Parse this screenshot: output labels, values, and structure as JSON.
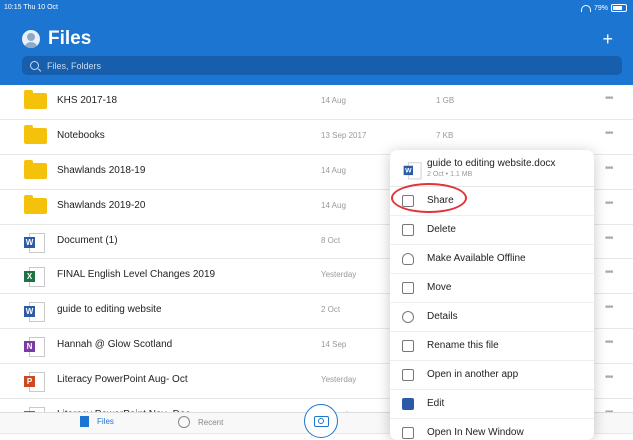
{
  "status": {
    "time": "10:15  Thu 10 Oct",
    "battery": "79%"
  },
  "header": {
    "title": "Files",
    "search_placeholder": "Files, Folders"
  },
  "files": [
    {
      "name": "KHS 2017-18",
      "date": "14 Aug",
      "size": "1 GB",
      "type": "folder"
    },
    {
      "name": "Notebooks",
      "date": "13 Sep 2017",
      "size": "7 KB",
      "type": "folder"
    },
    {
      "name": "Shawlands 2018-19",
      "date": "14 Aug",
      "size": "",
      "type": "folder"
    },
    {
      "name": "Shawlands 2019-20",
      "date": "14 Aug",
      "size": "",
      "type": "folder"
    },
    {
      "name": "Document (1)",
      "date": "8 Oct",
      "size": "",
      "type": "word"
    },
    {
      "name": "FINAL English Level Changes 2019",
      "date": "Yesterday",
      "size": "",
      "type": "excel"
    },
    {
      "name": "guide to editing website",
      "date": "2 Oct",
      "size": "",
      "type": "word"
    },
    {
      "name": "Hannah @ Glow Scotland",
      "date": "14 Sep",
      "size": "",
      "type": "onenote"
    },
    {
      "name": "Literacy PowerPoint Aug- Oct",
      "date": "Yesterday",
      "size": "",
      "type": "ppt"
    },
    {
      "name": "Literacy PowerPoint Nov- Dec",
      "date": "Yesterday",
      "size": "",
      "type": "ppt"
    }
  ],
  "icon_letters": {
    "word": "W",
    "excel": "X",
    "onenote": "N",
    "ppt": "P"
  },
  "more_glyph": "•••",
  "context_menu": {
    "file_name": "guide to editing website.docx",
    "file_meta": "2 Oct • 1.1 MB",
    "items": [
      {
        "label": "Share",
        "icon": "share-icon"
      },
      {
        "label": "Delete",
        "icon": "trash-icon"
      },
      {
        "label": "Make Available Offline",
        "icon": "cloud-download-icon"
      },
      {
        "label": "Move",
        "icon": "move-icon"
      },
      {
        "label": "Details",
        "icon": "info-icon"
      },
      {
        "label": "Rename this file",
        "icon": "rename-icon"
      },
      {
        "label": "Open in another app",
        "icon": "open-external-icon"
      },
      {
        "label": "Edit",
        "icon": "word-edit-icon"
      },
      {
        "label": "Open In New Window",
        "icon": "new-window-icon"
      }
    ]
  },
  "tabs": {
    "files": "Files",
    "recent": "Recent"
  },
  "colors": {
    "accent": "#1d75d2",
    "highlight": "#e0343a"
  }
}
